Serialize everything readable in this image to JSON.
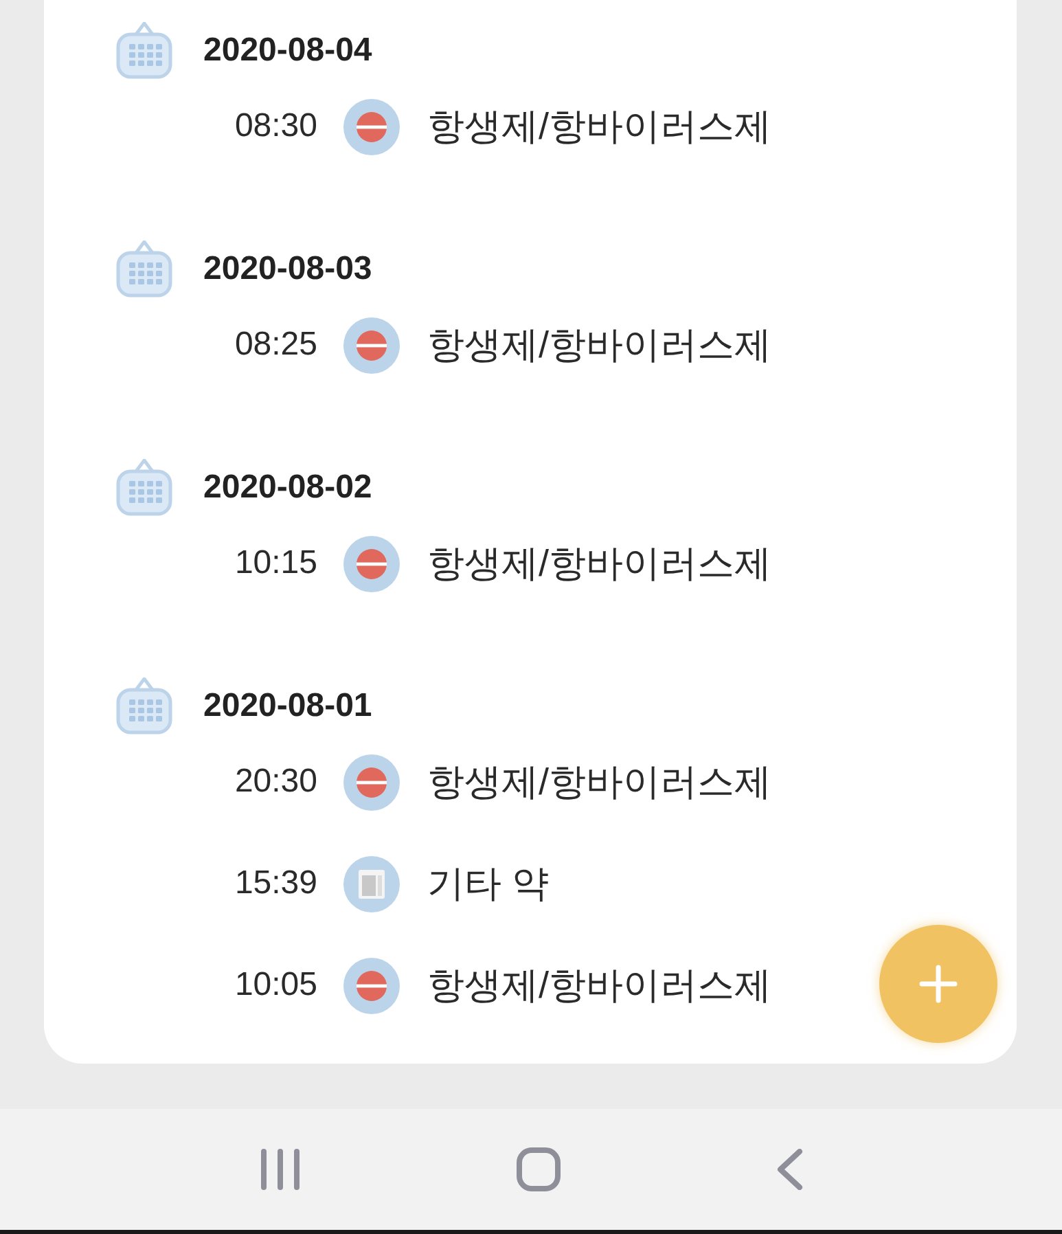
{
  "days": [
    {
      "date": "2020-08-04",
      "entries": [
        {
          "time": "08:30",
          "kind": "pill",
          "name": "항생제/항바이러스제"
        }
      ]
    },
    {
      "date": "2020-08-03",
      "entries": [
        {
          "time": "08:25",
          "kind": "pill",
          "name": "항생제/항바이러스제"
        }
      ]
    },
    {
      "date": "2020-08-02",
      "entries": [
        {
          "time": "10:15",
          "kind": "pill",
          "name": "항생제/항바이러스제"
        }
      ]
    },
    {
      "date": "2020-08-01",
      "entries": [
        {
          "time": "20:30",
          "kind": "pill",
          "name": "항생제/항바이러스제"
        },
        {
          "time": "15:39",
          "kind": "sheet",
          "name": "기타 약"
        },
        {
          "time": "10:05",
          "kind": "pill",
          "name": "항생제/항바이러스제"
        }
      ]
    }
  ]
}
